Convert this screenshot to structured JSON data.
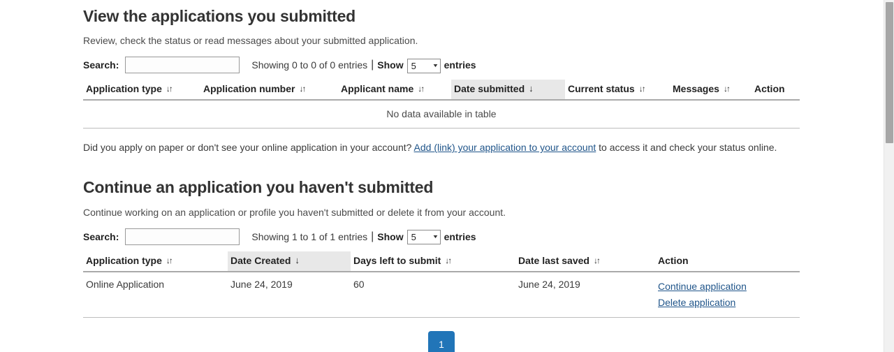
{
  "submitted_section": {
    "title": "View the applications you submitted",
    "description": "Review, check the status or read messages about your submitted application.",
    "search_label": "Search:",
    "search_value": "",
    "search_placeholder": "",
    "showing_text": "Showing 0 to 0 of 0 entries",
    "separator": "|",
    "show_label": "Show",
    "page_length": "5",
    "entries_label": "entries",
    "columns": [
      {
        "label": "Application type",
        "sort": "both"
      },
      {
        "label": "Application number",
        "sort": "both"
      },
      {
        "label": "Applicant name",
        "sort": "both"
      },
      {
        "label": "Date submitted",
        "sort": "desc"
      },
      {
        "label": "Current status",
        "sort": "both"
      },
      {
        "label": "Messages",
        "sort": "both"
      },
      {
        "label": "Action",
        "sort": "none"
      }
    ],
    "empty_message": "No data available in table",
    "note_before": "Did you apply on paper or don't see your online application in your account?",
    "note_link": "Add (link) your application to your account",
    "note_after": "to access it and check your status online."
  },
  "draft_section": {
    "title": "Continue an application you haven't submitted",
    "description": "Continue working on an application or profile you haven't submitted or delete it from your account.",
    "search_label": "Search:",
    "search_value": "",
    "search_placeholder": "",
    "showing_text": "Showing 1 to 1 of 1 entries",
    "separator": "|",
    "show_label": "Show",
    "page_length": "5",
    "entries_label": "entries",
    "columns": [
      {
        "label": "Application type",
        "sort": "both"
      },
      {
        "label": "Date Created",
        "sort": "desc"
      },
      {
        "label": "Days left to submit",
        "sort": "both"
      },
      {
        "label": "Date last saved",
        "sort": "both"
      },
      {
        "label": "Action",
        "sort": "none"
      }
    ],
    "rows": [
      {
        "application_type": "Online Application",
        "date_created": "June 24, 2019",
        "days_left": "60",
        "date_last_saved": "June 24, 2019",
        "action_continue": "Continue application",
        "action_delete": "Delete application"
      }
    ]
  },
  "pagination": {
    "current_page": "1"
  },
  "icons": {
    "sort_both": "↓↑",
    "sort_desc": "↓",
    "select_caret": "▼"
  },
  "colors": {
    "accent": "#2175b8",
    "link": "#20558a",
    "sorted_header_bg": "#e8e8e8",
    "heading": "#333333"
  }
}
